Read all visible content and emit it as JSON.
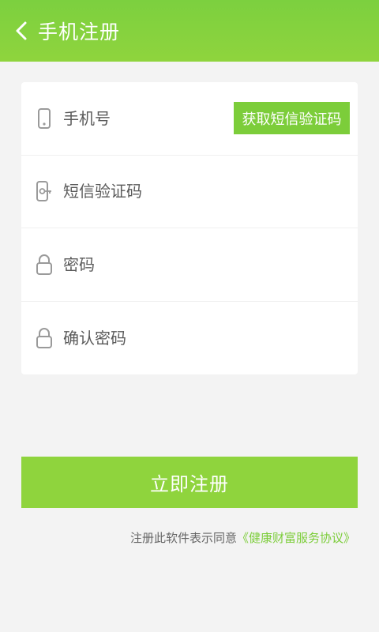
{
  "header": {
    "title": "手机注册",
    "back_icon": "chevron-left-icon"
  },
  "form": {
    "phone": {
      "placeholder": "手机号",
      "value": "",
      "icon": "phone-icon"
    },
    "get_code_button": "获取短信验证码",
    "sms_code": {
      "placeholder": "短信验证码",
      "value": "",
      "icon": "phone-key-icon"
    },
    "password": {
      "placeholder": "密码",
      "value": "",
      "icon": "lock-icon"
    },
    "confirm_password": {
      "placeholder": "确认密码",
      "value": "",
      "icon": "lock-icon"
    }
  },
  "submit_button": "立即注册",
  "agreement": {
    "text": "注册此软件表示同意",
    "link": "《健康财富服务协议》"
  },
  "colors": {
    "accent": "#8fd43d",
    "button": "#7ccd3a",
    "background": "#f3f3f3"
  }
}
